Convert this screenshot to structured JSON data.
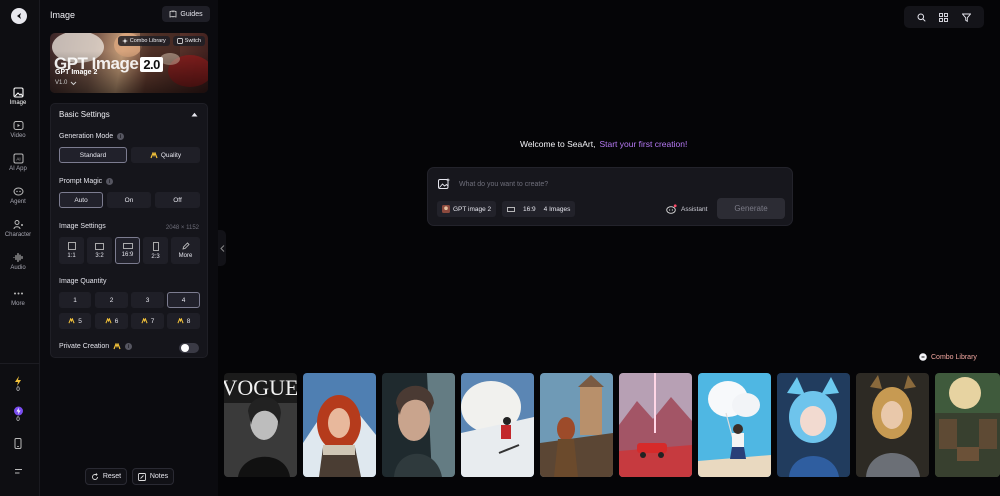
{
  "rail": {
    "items": [
      {
        "label": "Image"
      },
      {
        "label": "Video"
      },
      {
        "label": "AI App"
      },
      {
        "label": "Agent"
      },
      {
        "label": "Character"
      },
      {
        "label": "Audio"
      },
      {
        "label": "More"
      }
    ],
    "counts": [
      "0",
      "0"
    ]
  },
  "panel": {
    "title": "Image",
    "guides_label": "Guides",
    "banner": {
      "combo_label": "Combo Library",
      "switch_label": "Switch",
      "big_title": "GPT Image",
      "big_version": "2.0",
      "model_name": "GPT Image 2",
      "version": "V1.0"
    },
    "basic_settings": "Basic Settings",
    "generation_mode": {
      "label": "Generation Mode",
      "options": [
        "Standard",
        "Quality"
      ],
      "selected": "Standard"
    },
    "prompt_magic": {
      "label": "Prompt Magic",
      "options": [
        "Auto",
        "On",
        "Off"
      ],
      "selected": "Auto"
    },
    "image_settings": {
      "label": "Image Settings",
      "dimensions": "2048 × 1152",
      "ratios": [
        "1:1",
        "3:2",
        "16:9",
        "2:3",
        "More"
      ],
      "selected": "16:9"
    },
    "image_quantity": {
      "label": "Image Quantity",
      "options": [
        "1",
        "2",
        "3",
        "4"
      ],
      "premium": [
        "5",
        "6",
        "7",
        "8"
      ],
      "selected": "4"
    },
    "private_creation": "Private Creation",
    "reset_label": "Reset",
    "notes_label": "Notes"
  },
  "main": {
    "welcome": "Welcome to SeaArt,",
    "welcome_highlight": "Start your first creation!",
    "prompt_placeholder": "What do you want to create?",
    "model_chip": "GPT image 2",
    "ratio_chip": "16:9",
    "count_chip": "4 Images",
    "assistant_label": "Assistant",
    "generate_label": "Generate",
    "combo_library": "Combo Library",
    "cover_text": "VOGUE"
  },
  "colors": {
    "accent": "#b679f4",
    "combo": "#f2a7a0",
    "premium": "#f3c23a"
  }
}
